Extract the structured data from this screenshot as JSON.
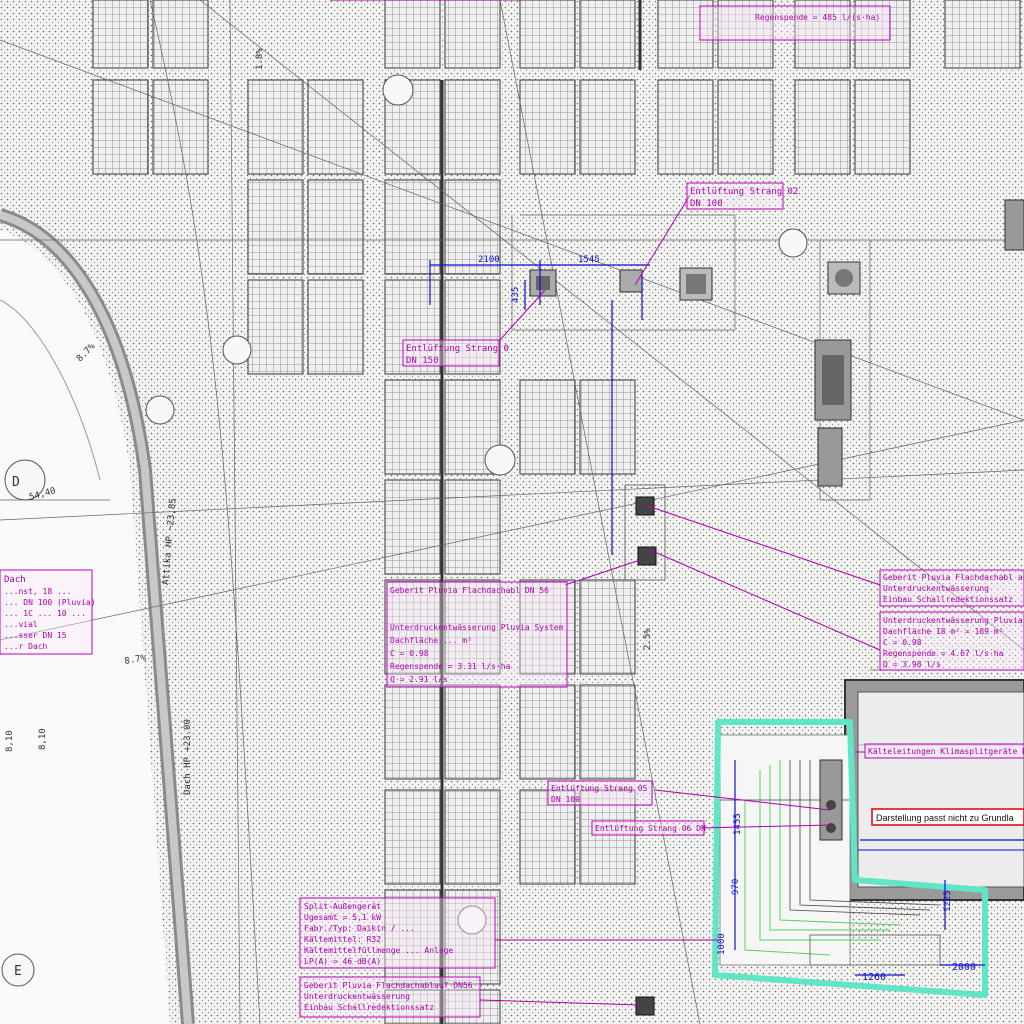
{
  "labels": {
    "entl_strang_02": "Entlüftung Strang 02",
    "dn_100_a": "DN 100",
    "entl_strang_03": "Entlüftung Strang 0",
    "dn_150": "DN 150",
    "dach_a": "Dach",
    "dach_line2": "...nst, 18 ...",
    "dach_line3": "... DN 100 (Pluvia)",
    "dach_line4": "... 1C ... 10 ...",
    "dach_line5": "...vial",
    "dach_line6": "...sser DN 15",
    "dach_line7": "...r Dach",
    "geberit_pluvia_1": "Geberit Pluvia Flachdachabl auf D",
    "geberit_pluvia_1b": "Unterdruckentwässerung",
    "geberit_pluvia_1c": "Einbau Schallredektionssatz",
    "unterdruck_pluvia": "Unterdruckentwässerung Pluvia",
    "dachflaeche": "Dachfläche 18 m² = 189 m²",
    "c_value": "C = 0.98",
    "regenspende": "Regenspende = 4.67 l/s·ha",
    "q_value": "Q = 3.98 l/s",
    "kalteleitungen": "Kälteleitungen Klimasplitgeräte DN",
    "darstellung": "Darstellung passt nicht zu Grundla",
    "entl_strang_05": "Entlüftung Strang 05",
    "entl_strang_06": "Entlüftung Strang 06 DN",
    "split_aussengeraet": "Split-Außengerät",
    "split_line2": "Ugesamt = 5,1 kW",
    "split_line3": "Fabr./Typ: Daikin / ...",
    "split_line4": "Kältemittel: R32",
    "split_line5": "Kältemittelfüllmenge ... Anlage",
    "split_line6": "LP(A) = 46 dB(A)",
    "geberit_pluvia_2": "Geberit Pluvia Flachdachablauf DN56",
    "geberit_pluvia_2b": "Unterdruckentwässerung",
    "geberit_pluvia_2c": "Einbau Schallredektionssatz",
    "geberit_mid_1": "Geberit Pluvia Flachdachabl DN 56",
    "geberit_mid_2": "Unterdruckentwässerung Pluvia System",
    "geberit_mid_3": "Dachfläche ... m²",
    "geberit_mid_4": "C = 0.98",
    "geberit_mid_5": "Regenspende = 3.31 l/s·ha",
    "geberit_mid_6": "Q = 2.91 l/s",
    "regenspende_top": "Regenspende = 485 l/(s·ha)",
    "dim_2100": "2100",
    "dim_1545": "1545",
    "dim_435": "435",
    "dim_1260": "1260",
    "dim_2000": "2000",
    "dim_1000": "1000",
    "dim_970": "970",
    "dim_1225": "1225",
    "dim_1455": "1455",
    "dach_23": "Dach HP +23.00",
    "pct_87": "8.7%",
    "pct_25": "2.5%",
    "pct_18": "1.8%",
    "dim_810": "8,10",
    "axis_e": "E",
    "axis_d": "D",
    "dim_5440": "54,40",
    "attika": "Attika HP ~23,85"
  },
  "colors": {
    "magenta": "#b000b0",
    "blue": "#1010d0",
    "highlight": "#5ee6c6",
    "alert_red": "#e00000"
  }
}
